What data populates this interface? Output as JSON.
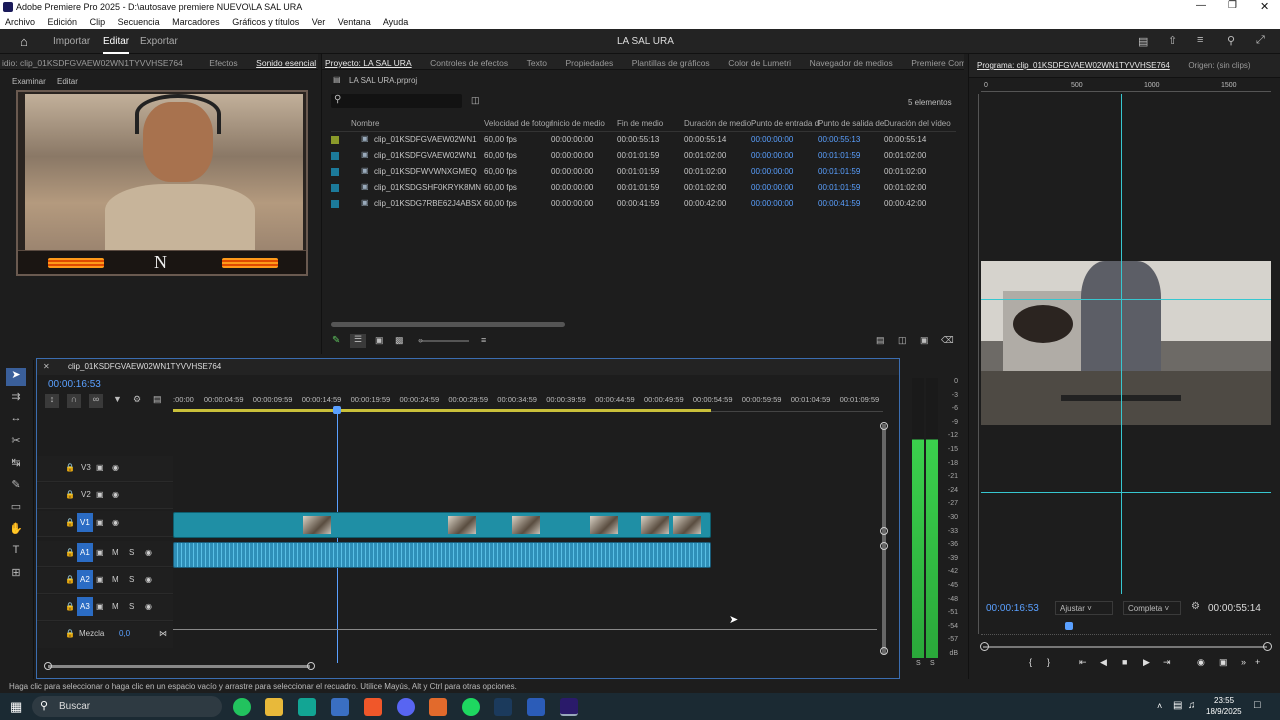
{
  "app": {
    "title": "Adobe Premiere Pro 2025 - D:\\autosave premiere NUEVO\\LA SAL URA"
  },
  "menu": [
    "Archivo",
    "Edición",
    "Clip",
    "Secuencia",
    "Marcadores",
    "Gráficos y títulos",
    "Ver",
    "Ventana",
    "Ayuda"
  ],
  "workspace": {
    "import": "Importar",
    "edit": "Editar",
    "export": "Exportar",
    "project_title": "LA SAL URA"
  },
  "left_panel": {
    "tabs": [
      "idio: clip_01KSDFGVAEW02WN1TYVVHSE764",
      "Efectos",
      "Sonido esencial"
    ],
    "subtabs": [
      "Examinar",
      "Editar"
    ],
    "letter_n": "N"
  },
  "project_panel": {
    "tabs": [
      "Proyecto: LA SAL URA",
      "Controles de efectos",
      "Texto",
      "Propiedades",
      "Plantillas de gráficos",
      "Color de Lumetri",
      "Navegador de medios",
      "Premiere Com"
    ],
    "file": "LA SAL URA.prproj",
    "count": "5 elementos",
    "columns": [
      "Nombre",
      "Velocidad de fotogr",
      "Inicio de medio",
      "Fin de medio",
      "Duración de medio",
      "Punto de entrada d",
      "Punto de salida de",
      "Duración del vídeo"
    ],
    "rows": [
      [
        "clip_01KSDFGVAEW02WN1",
        "60,00 fps",
        "00:00:00:00",
        "00:00:55:13",
        "00:00:55:14",
        "00:00:00:00",
        "00:00:55:13",
        "00:00:55:14"
      ],
      [
        "clip_01KSDFGVAEW02WN1",
        "60,00 fps",
        "00:00:00:00",
        "00:01:01:59",
        "00:01:02:00",
        "00:00:00:00",
        "00:01:01:59",
        "00:01:02:00"
      ],
      [
        "clip_01KSDFWVWNXGMEQ",
        "60,00 fps",
        "00:00:00:00",
        "00:01:01:59",
        "00:01:02:00",
        "00:00:00:00",
        "00:01:01:59",
        "00:01:02:00"
      ],
      [
        "clip_01KSDGSHF0KRYK8MN",
        "60,00 fps",
        "00:00:00:00",
        "00:01:01:59",
        "00:01:02:00",
        "00:00:00:00",
        "00:01:01:59",
        "00:01:02:00"
      ],
      [
        "clip_01KSDG7RBE62J4ABSX",
        "60,00 fps",
        "00:00:00:00",
        "00:00:41:59",
        "00:00:42:00",
        "00:00:00:00",
        "00:00:41:59",
        "00:00:42:00"
      ]
    ]
  },
  "program": {
    "tab": "Programa: clip_01KSDFGVAEW02WN1TYVVHSE764",
    "source_tab": "Origen: (sin clips)",
    "ruler": [
      "0",
      "500",
      "1000",
      "1500"
    ],
    "timecode": "00:00:16:53",
    "fit": "Ajustar",
    "quality": "Completa",
    "duration": "00:00:55:14"
  },
  "timeline": {
    "tab": "clip_01KSDFGVAEW02WN1TYVVHSE764",
    "timecode": "00:00:16:53",
    "ruler": [
      ":00:00",
      "00:00:04:59",
      "00:00:09:59",
      "00:00:14:59",
      "00:00:19:59",
      "00:00:24:59",
      "00:00:29:59",
      "00:00:34:59",
      "00:00:39:59",
      "00:00:44:59",
      "00:00:49:59",
      "00:00:54:59",
      "00:00:59:59",
      "00:01:04:59",
      "00:01:09:59"
    ],
    "tracks": [
      "V3",
      "V2",
      "V1",
      "A1",
      "A2",
      "A3"
    ],
    "mix": "Mezcla",
    "mix_val": "0,0",
    "meter_scale": [
      "0",
      "-3",
      "-6",
      "-9",
      "-12",
      "-15",
      "-18",
      "-21",
      "-24",
      "-27",
      "-30",
      "-33",
      "-36",
      "-39",
      "-42",
      "-45",
      "-48",
      "-51",
      "-54",
      "-57",
      "dB"
    ]
  },
  "status": "Haga clic para seleccionar o haga clic en un espacio vacío y arrastre para seleccionar el recuadro. Utilice Mayús, Alt y Ctrl para otras opciones.",
  "taskbar": {
    "search": "Buscar",
    "time": "23:55",
    "date": "18/9/2025"
  }
}
